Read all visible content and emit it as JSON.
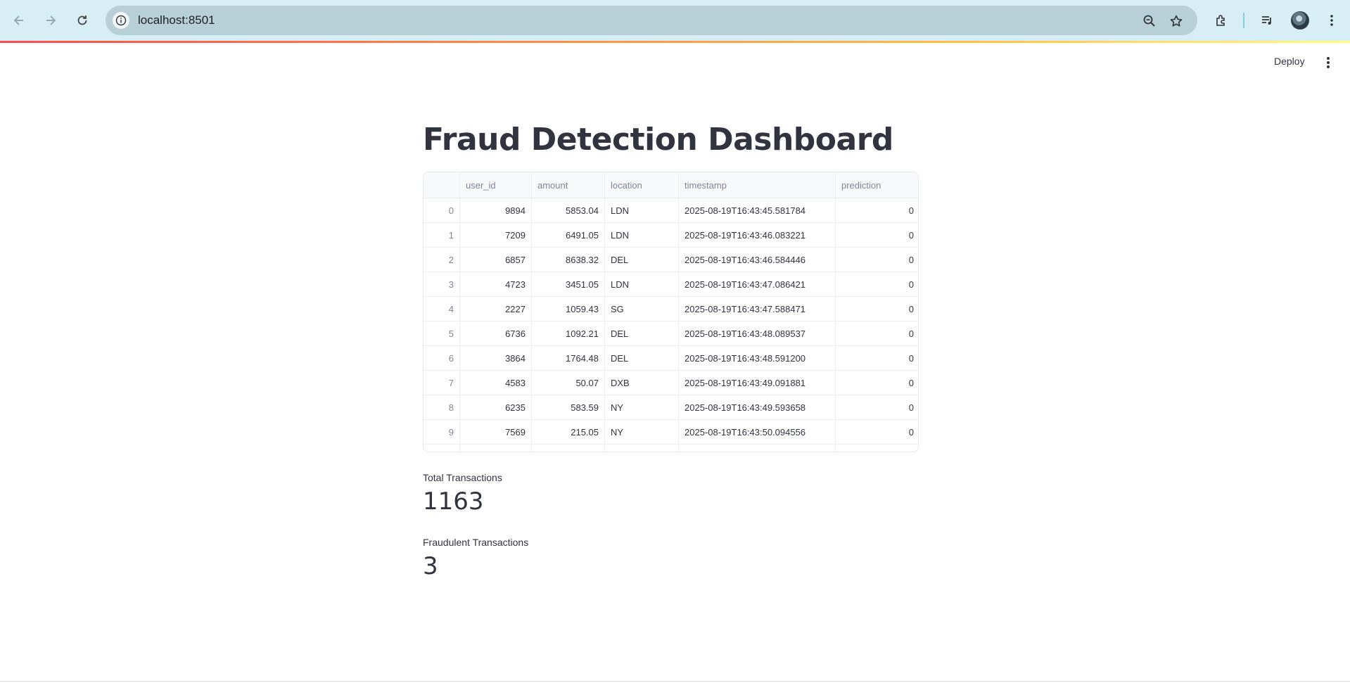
{
  "browser": {
    "url": "localhost:8501"
  },
  "header": {
    "deploy_label": "Deploy"
  },
  "page": {
    "title": "Fraud Detection Dashboard"
  },
  "table": {
    "columns": [
      "",
      "user_id",
      "amount",
      "location",
      "timestamp",
      "prediction"
    ],
    "rows": [
      [
        "0",
        "9894",
        "5853.04",
        "LDN",
        "2025-08-19T16:43:45.581784",
        "0"
      ],
      [
        "1",
        "7209",
        "6491.05",
        "LDN",
        "2025-08-19T16:43:46.083221",
        "0"
      ],
      [
        "2",
        "6857",
        "8638.32",
        "DEL",
        "2025-08-19T16:43:46.584446",
        "0"
      ],
      [
        "3",
        "4723",
        "3451.05",
        "LDN",
        "2025-08-19T16:43:47.086421",
        "0"
      ],
      [
        "4",
        "2227",
        "1059.43",
        "SG",
        "2025-08-19T16:43:47.588471",
        "0"
      ],
      [
        "5",
        "6736",
        "1092.21",
        "DEL",
        "2025-08-19T16:43:48.089537",
        "0"
      ],
      [
        "6",
        "3864",
        "1764.48",
        "DEL",
        "2025-08-19T16:43:48.591200",
        "0"
      ],
      [
        "7",
        "4583",
        "50.07",
        "DXB",
        "2025-08-19T16:43:49.091881",
        "0"
      ],
      [
        "8",
        "6235",
        "583.59",
        "NY",
        "2025-08-19T16:43:49.593658",
        "0"
      ],
      [
        "9",
        "7569",
        "215.05",
        "NY",
        "2025-08-19T16:43:50.094556",
        "0"
      ]
    ]
  },
  "metrics": {
    "total_label": "Total Transactions",
    "total_value": "1163",
    "fraud_label": "Fraudulent Transactions",
    "fraud_value": "3"
  }
}
